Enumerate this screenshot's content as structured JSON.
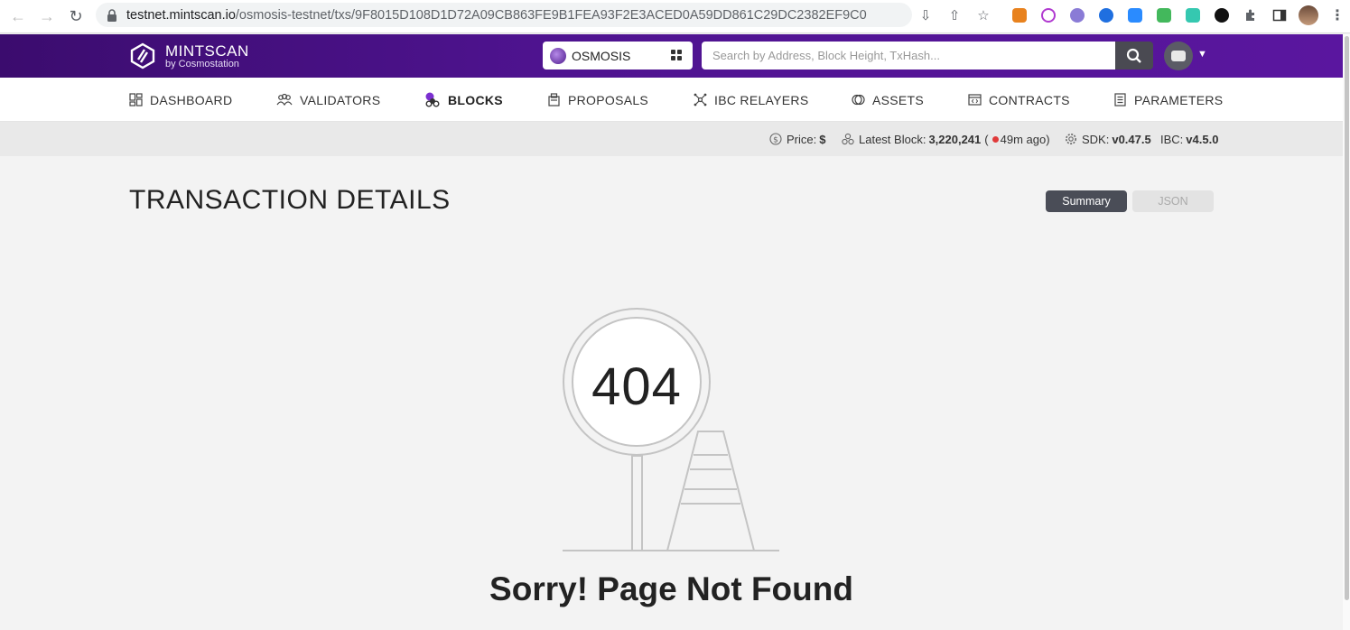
{
  "browser": {
    "url_host": "testnet.mintscan.io",
    "url_path": "/osmosis-testnet/txs/9F8015D108D1D72A09CB863FE9B1FEA93F2E3ACED0A59DD861C29DC2382EF9C0"
  },
  "header": {
    "logo_title": "MINTSCAN",
    "logo_subtitle": "by Cosmostation",
    "chain": "OSMOSIS",
    "search_placeholder": "Search by Address, Block Height, TxHash..."
  },
  "nav": {
    "items": [
      {
        "label": "DASHBOARD"
      },
      {
        "label": "VALIDATORS"
      },
      {
        "label": "BLOCKS"
      },
      {
        "label": "PROPOSALS"
      },
      {
        "label": "IBC RELAYERS"
      },
      {
        "label": "ASSETS"
      },
      {
        "label": "CONTRACTS"
      },
      {
        "label": "PARAMETERS"
      }
    ],
    "active": "BLOCKS"
  },
  "status": {
    "price_label": "Price:",
    "price_value": "$",
    "block_label": "Latest Block:",
    "block_value": "3,220,241",
    "block_age_open": "(",
    "block_age": "49m ago)",
    "sdk_label": "SDK:",
    "sdk_value": "v0.47.5",
    "ibc_label": "IBC:",
    "ibc_value": "v4.5.0"
  },
  "page": {
    "title": "TRANSACTION DETAILS",
    "toggle_summary": "Summary",
    "toggle_json": "JSON",
    "error_code": "404",
    "error_message": "Sorry! Page Not Found"
  },
  "colors": {
    "header_purple": "#4e138f",
    "status_red": "#e03a3a",
    "toggle_active": "#4a4d57"
  }
}
